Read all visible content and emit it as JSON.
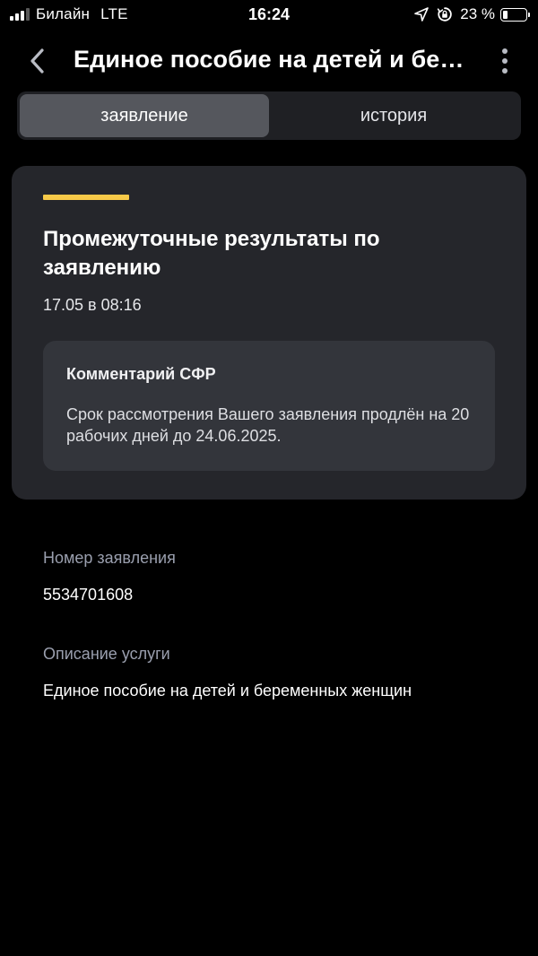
{
  "status_bar": {
    "carrier": "Билайн",
    "network": "LTE",
    "time": "16:24",
    "battery_percent": "23 %",
    "battery_level": 0.23,
    "icons": [
      "signal-icon",
      "location-arrow-icon",
      "orientation-lock-icon",
      "battery-icon"
    ]
  },
  "header": {
    "title": "Единое пособие на детей и беременных женщин",
    "back_icon": "chevron-left-icon",
    "menu_icon": "more-vertical-icon"
  },
  "tabs": [
    {
      "label": "заявление",
      "active": true
    },
    {
      "label": "история",
      "active": false
    }
  ],
  "status_card": {
    "accent_color": "#f7c948",
    "title": "Промежуточные результаты по заявлению",
    "date": "17.05 в 08:16",
    "comment": {
      "title": "Комментарий СФР",
      "text": "Срок рассмотрения Вашего заявления продлён на 20 рабочих дней до 24.06.2025."
    }
  },
  "details": {
    "application_number": {
      "label": "Номер заявления",
      "value": "5534701608"
    },
    "service_description": {
      "label": "Описание услуги",
      "value": "Единое пособие на детей и беременных женщин"
    }
  },
  "colors": {
    "background": "#000000",
    "card": "#25262b",
    "comment_box": "#33353b",
    "accent": "#f7c948",
    "muted_text": "#9a9fae"
  }
}
